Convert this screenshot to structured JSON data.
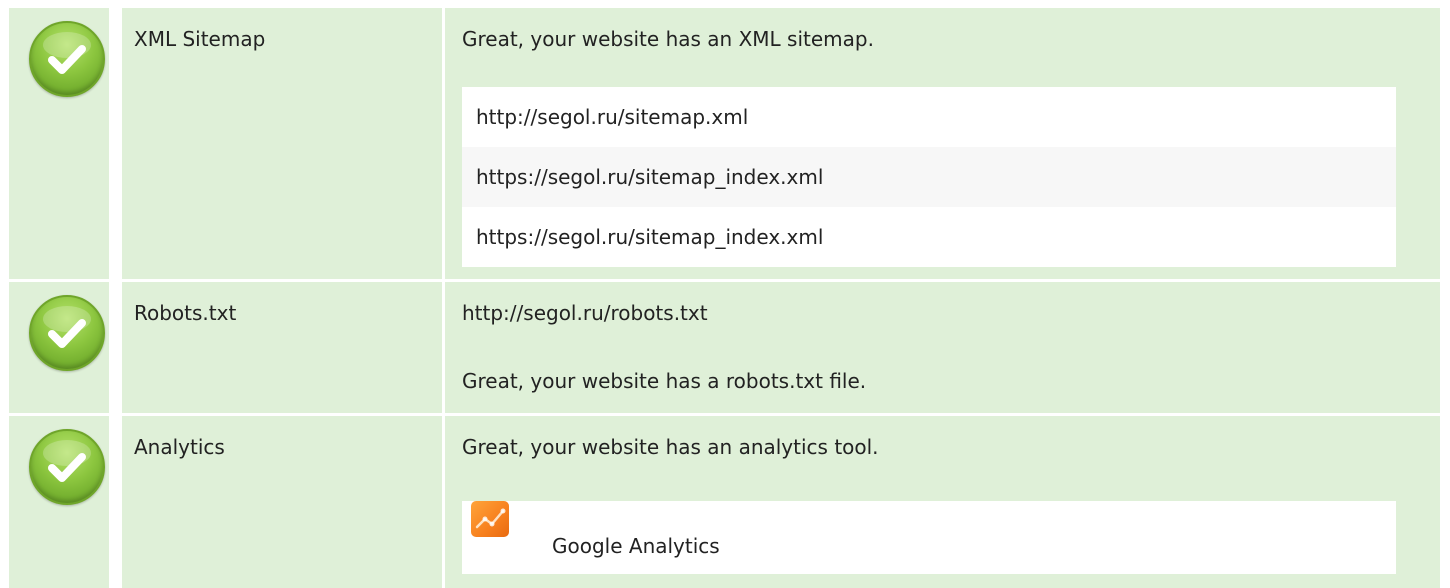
{
  "colors": {
    "row_background": "#dff0d8",
    "check_green": "#8cc63f",
    "analytics_orange": "#f7801e"
  },
  "rows": [
    {
      "status_icon": "check-circle-icon",
      "label": "XML Sitemap",
      "message": "Great, your website has an XML sitemap.",
      "sitemaps": [
        "http://segol.ru/sitemap.xml",
        "https://segol.ru/sitemap_index.xml",
        "https://segol.ru/sitemap_index.xml"
      ]
    },
    {
      "status_icon": "check-circle-icon",
      "label": "Robots.txt",
      "url": "http://segol.ru/robots.txt",
      "message": "Great, your website has a robots.txt file."
    },
    {
      "status_icon": "check-circle-icon",
      "label": "Analytics",
      "message": "Great, your website has an analytics tool.",
      "tools": [
        {
          "icon": "google-analytics-icon",
          "name": "Google Analytics"
        }
      ]
    }
  ]
}
